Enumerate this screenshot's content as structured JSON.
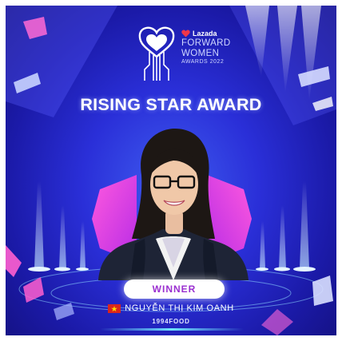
{
  "brand": {
    "lazada": "Lazada",
    "line1": "FORWARD",
    "line2": "WOMEN",
    "line3": "AWARDS 2022"
  },
  "award": {
    "title": "RISING STAR AWARD"
  },
  "badge": {
    "label": "WINNER"
  },
  "winner": {
    "name": "NGUYỄN THỊ KIM OANH",
    "company": "1994FOOD",
    "flag": "vietnam-flag-icon"
  },
  "colors": {
    "background": "#2a2fd8",
    "accent_pink": "#ff4fd8",
    "badge_text": "#9a2fd0",
    "lazada_red": "#f0364a"
  }
}
